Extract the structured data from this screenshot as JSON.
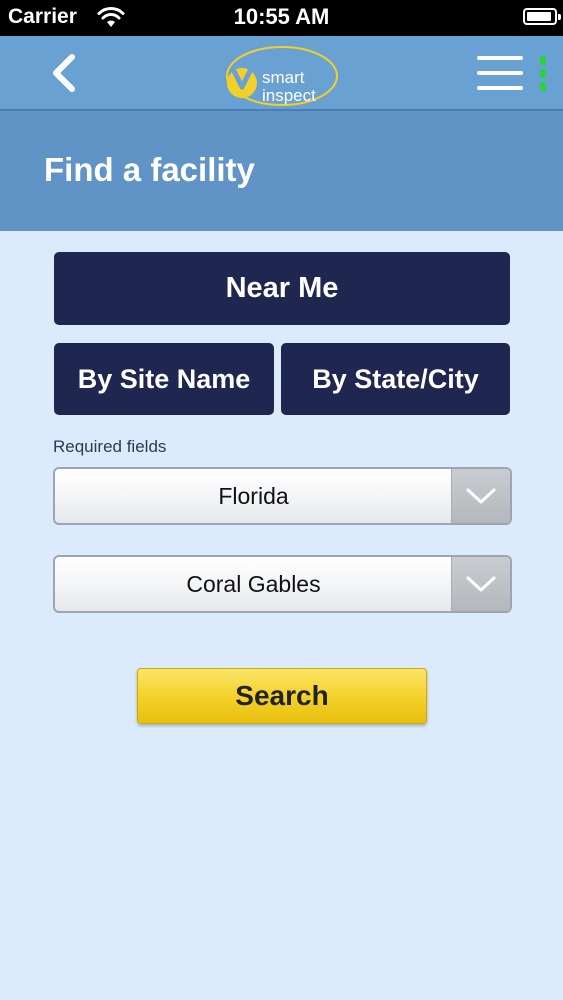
{
  "status_bar": {
    "carrier": "Carrier",
    "time": "10:55 AM"
  },
  "nav": {
    "logo_line1": "smart",
    "logo_line2": "inspect"
  },
  "page": {
    "title": "Find a facility"
  },
  "search_modes": {
    "near_me": "Near Me",
    "by_site_name": "By Site Name",
    "by_state_city": "By State/City"
  },
  "form": {
    "required_label": "Required fields",
    "state_value": "Florida",
    "city_value": "Coral Gables",
    "search_label": "Search"
  },
  "colors": {
    "navbar": "#6aa1d3",
    "title_bar": "#6093c6",
    "background": "#dcebfb",
    "dark_button": "#1f2650",
    "search_button": "#f4d22a",
    "status_indicator": "#2bd23a"
  },
  "icons": {
    "back": "chevron-left-icon",
    "menu": "hamburger-menu-icon",
    "dropdown": "chevron-down-icon",
    "wifi": "wifi-icon",
    "battery": "battery-icon"
  }
}
